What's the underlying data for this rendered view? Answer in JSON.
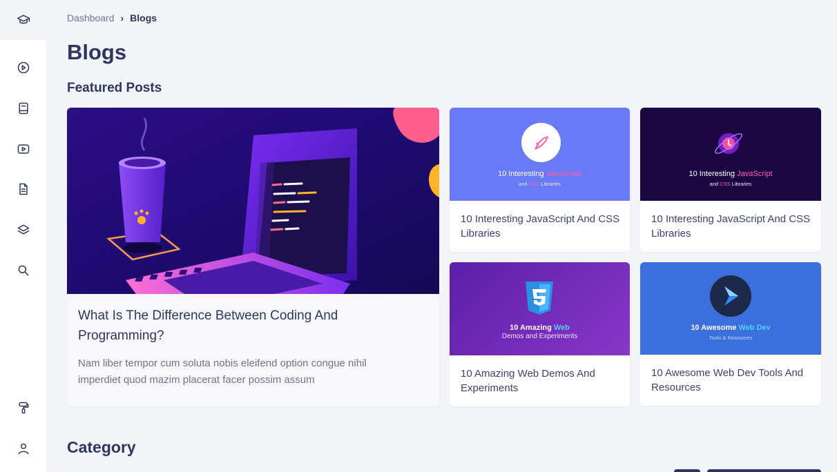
{
  "breadcrumb": {
    "home": "Dashboard",
    "separator": "›",
    "current": "Blogs"
  },
  "page": {
    "title": "Blogs"
  },
  "sections": {
    "featured": "Featured Posts",
    "category": "Category"
  },
  "sidebar": {
    "items": [
      {
        "icon": "graduation-cap-icon",
        "active": true
      },
      {
        "icon": "play-circle-icon"
      },
      {
        "icon": "book-icon"
      },
      {
        "icon": "video-icon"
      },
      {
        "icon": "document-icon"
      },
      {
        "icon": "layers-icon"
      },
      {
        "icon": "search-icon"
      },
      {
        "icon": "paint-roller-icon"
      },
      {
        "icon": "user-icon"
      }
    ]
  },
  "featured": {
    "main": {
      "title": "What Is The Difference Between Coding And Programming?",
      "excerpt": "Nam liber tempor cum soluta nobis eleifend option congue nihil imperdiet quod mazim placerat facer possim assum"
    },
    "cards": [
      {
        "title": "10 Interesting JavaScript And CSS Libraries",
        "thumb": {
          "pre": "10 Interesting ",
          "hl": "JavaScript",
          "sub_hl": "CSS",
          "sub_pre": "and ",
          "sub_post": " Libraries"
        }
      },
      {
        "title": "10 Interesting JavaScript And CSS Libraries",
        "thumb": {
          "pre": "10 Interesting ",
          "hl": "JavaScript",
          "sub_hl": "CSS",
          "sub_pre": "and ",
          "sub_post": " Libraries"
        }
      },
      {
        "title": "10 Amazing Web Demos And Experiments",
        "thumb": {
          "pre": "10 Amazing ",
          "hl": "Web",
          "sub": "Demos and Experiments"
        }
      },
      {
        "title": "10 Awesome Web Dev Tools And Resources",
        "thumb": {
          "pre": "10 Awesome ",
          "hl": "Web Dev",
          "sub": "Tools & Resources"
        }
      }
    ]
  },
  "colors": {
    "primary_text": "#2d3561",
    "accent_pink": "#ff5fa8",
    "accent_blue": "#4fd2ff",
    "card_blue": "#6a79f6",
    "card_dark": "#1b0744",
    "card_purple": "#6d2bb3",
    "card_royal": "#3a6fdc"
  }
}
